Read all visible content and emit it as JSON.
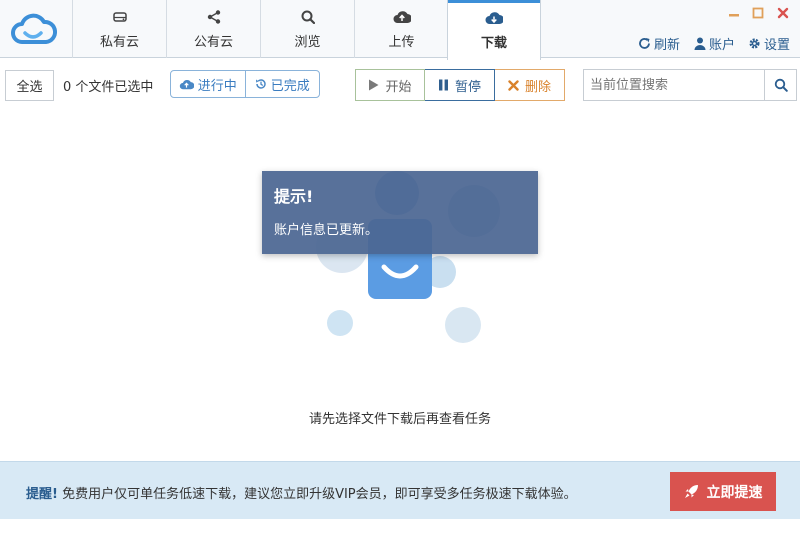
{
  "header": {
    "tabs": [
      {
        "label": "私有云",
        "icon": "hard-drive-icon"
      },
      {
        "label": "公有云",
        "icon": "share-icon"
      },
      {
        "label": "浏览",
        "icon": "search-icon"
      },
      {
        "label": "上传",
        "icon": "cloud-upload-icon"
      },
      {
        "label": "下载",
        "icon": "cloud-download-icon",
        "active": true
      }
    ],
    "actions": {
      "refresh_label": "刷新",
      "account_label": "账户",
      "settings_label": "设置"
    }
  },
  "toolbar": {
    "select_all_label": "全选",
    "selection_count": "0 个文件已选中",
    "filter": {
      "in_progress_label": "进行中",
      "completed_label": "已完成"
    },
    "start_label": "开始",
    "pause_label": "暂停",
    "delete_label": "删除",
    "search_placeholder": "当前位置搜索"
  },
  "main": {
    "empty_message": "请先选择文件下载后再查看任务"
  },
  "toast": {
    "title": "提示!",
    "message": "账户信息已更新。"
  },
  "banner": {
    "prefix": "提醒!",
    "text": "免费用户仅可单任务低速下载，建议您立即升级VIP会员，即可享受多任务极速下载体验。",
    "boost_label": "立即提速"
  },
  "colors": {
    "accent": "#3c8fd8",
    "danger": "#d9534f",
    "toast_bg": "#4b6692",
    "banner_bg": "#d8e9f5"
  }
}
